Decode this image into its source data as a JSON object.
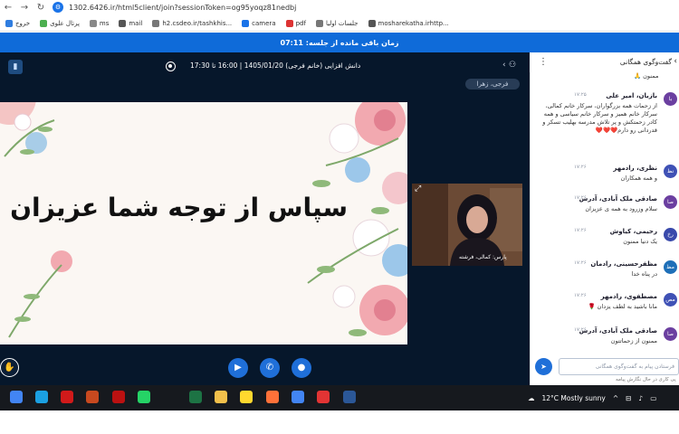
{
  "browser": {
    "url": "1302.6426.ir/html5client/join?sessionToken=og95yoqz81nedbj",
    "bookmarks": [
      {
        "label": "خروج",
        "color": "#2f7de0"
      },
      {
        "label": "پرتال علوی",
        "color": "#4caf50"
      },
      {
        "label": "ms",
        "color": "#888"
      },
      {
        "label": "mail",
        "color": "#555"
      },
      {
        "label": "h2.csdeo.ir/tashkhis...",
        "color": "#777"
      },
      {
        "label": "camera",
        "color": "#1a73e8"
      },
      {
        "label": "pdf",
        "color": "#d33"
      },
      {
        "label": "جلسات اولیا",
        "color": "#777"
      },
      {
        "label": "mosharekatha.irhttp...",
        "color": "#555"
      }
    ]
  },
  "timer": {
    "text": "زمان باقی مانده از جلسه: 07:11"
  },
  "meeting": {
    "title": "دانش افزایی (خانم فرجی) 1405/01/20 | 16:00 تا 17:30",
    "presenter_badge": "فرجی، زهرا",
    "slide_text": "سپاس از توجه شما عزیزان",
    "webcam_name": "پارس: کمالی، فرشته"
  },
  "controls": {
    "raise_hand": "hand-icon",
    "camera": "video-camera-icon",
    "phone": "phone-icon",
    "mic": "microphone-icon"
  },
  "chat": {
    "title": "گفت‌وگوی همگانی",
    "clipped_top": "ممنون 🙏",
    "messages": [
      {
        "initial": "با",
        "name": "بازبان، امیر علی",
        "time": "۱۷:۲۵",
        "text": "از زحمات همه بزرگواران، سرکار خانم کمالی، سرکار خانم همیز و سرکار خانم سیاسی و همه کادر زحمتکش و پر تلاش مدرسه بهلیب تسکر و قدردانی رو دارم❤️❤️❤️",
        "color": "#6b3fa0"
      },
      {
        "initial": "نظ",
        "name": "نظری، رادمهر",
        "time": "۱۷:۲۶",
        "text": "و همه همکاران",
        "color": "#3f51b5"
      },
      {
        "initial": "صا",
        "name": "صادقی ملک آبادی، آدرس",
        "time": "۱۷:۲۶",
        "text": "سلام وزرود به همه ی عزیزان",
        "color": "#6b3fa0"
      },
      {
        "initial": "رخ",
        "name": "رحیمی، کیاوش",
        "time": "۱۷:۲۶",
        "text": "یک دنیا ممنون",
        "color": "#3949ab"
      },
      {
        "initial": "مظ",
        "name": "مظفرحسینی، رادمان",
        "time": "۱۷:۲۶",
        "text": "در پناه خدا",
        "color": "#1e6fb8"
      },
      {
        "initial": "مص",
        "name": "مصطفوی، رادمهر",
        "time": "۱۷:۲۶",
        "text": "مانا باشید به لطف یزدان 🌹",
        "color": "#3f51b5"
      },
      {
        "initial": "صا",
        "name": "صادقی ملک آبادی، آدرس",
        "time": "۱۷:۲۶",
        "text": "ممنون از زحماتتون",
        "color": "#6b3fa0"
      }
    ],
    "input_placeholder": "فرستادن پیام به گفت‌وگوی همگانی",
    "typing_text": "پی کاری در حال نگارش پیامه"
  },
  "taskbar": {
    "weather": "12°C  Mostly sunny",
    "apps": [
      {
        "name": "chrome-icon",
        "color": "#4285f4"
      },
      {
        "name": "edge-icon",
        "color": "#1ba0e2"
      },
      {
        "name": "acrobat-icon",
        "color": "#d11a1a"
      },
      {
        "name": "powerpoint-icon",
        "color": "#c8491f"
      },
      {
        "name": "media-icon",
        "color": "#b11"
      },
      {
        "name": "whatsapp-icon",
        "color": "#25d366"
      },
      {
        "name": "excel-icon",
        "color": "#1d7344"
      },
      {
        "name": "explorer-icon",
        "color": "#f2c04b"
      },
      {
        "name": "sticky-icon",
        "color": "#ffd82e"
      },
      {
        "name": "firefox-icon",
        "color": "#ff7139"
      },
      {
        "name": "chrome2-icon",
        "color": "#4285f4"
      },
      {
        "name": "anydesk-icon",
        "color": "#e23434"
      },
      {
        "name": "word-icon",
        "color": "#2b5797"
      }
    ]
  }
}
